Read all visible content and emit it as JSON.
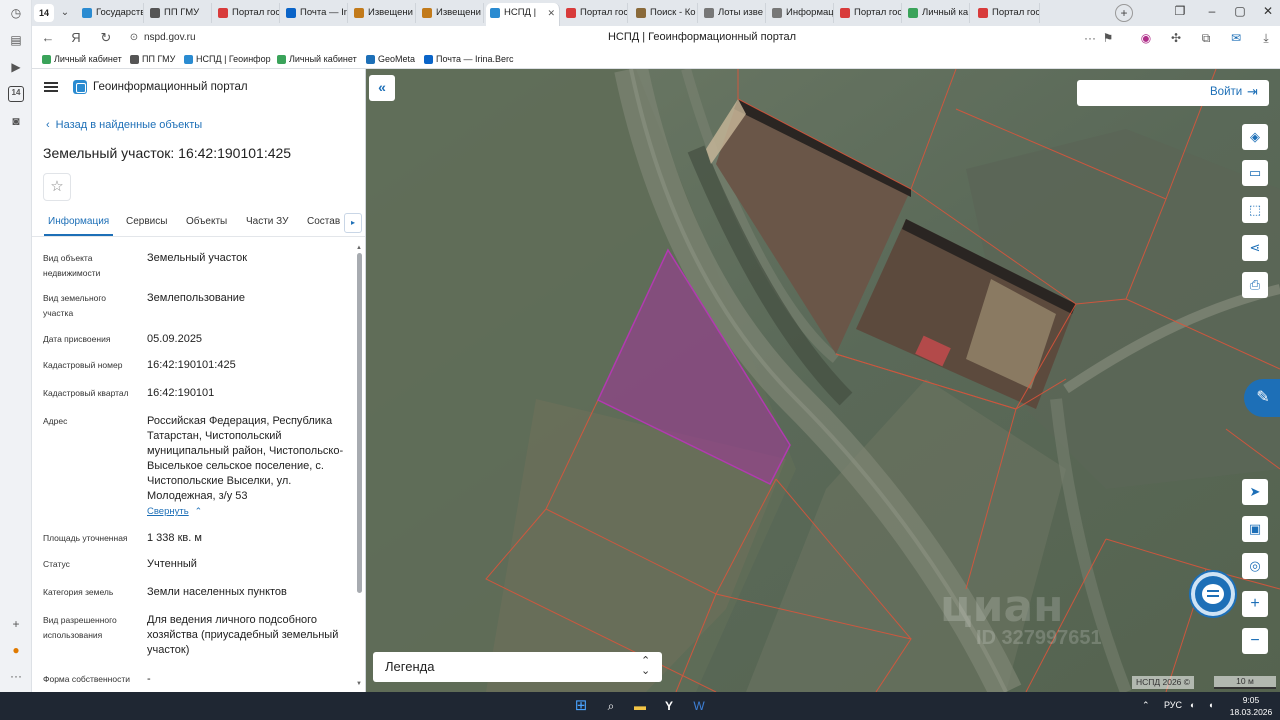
{
  "browser": {
    "tab_count": "14",
    "tabs": [
      {
        "label": "Государств",
        "color": "#2a8bd1"
      },
      {
        "label": "ПП ГМУ",
        "color": "#555555"
      },
      {
        "label": "Портал гос",
        "color": "#d83b3b"
      },
      {
        "label": "Почта — Ir",
        "color": "#0a64c8"
      },
      {
        "label": "Извещени",
        "color": "#c27a1a"
      },
      {
        "label": "Извещени",
        "color": "#c27a1a"
      },
      {
        "label": "НСПД |",
        "color": "#2a8bd1"
      },
      {
        "label": "Портал гос",
        "color": "#d83b3b"
      },
      {
        "label": "Поиск - Ко",
        "color": "#8a6a3a"
      },
      {
        "label": "Лоты изве",
        "color": "#777777"
      },
      {
        "label": "Информац",
        "color": "#777777"
      },
      {
        "label": "Портал гос",
        "color": "#d83b3b"
      },
      {
        "label": "Личный ка",
        "color": "#3aa35a"
      },
      {
        "label": "Портал гос",
        "color": "#d83b3b"
      }
    ],
    "url": "nspd.gov.ru",
    "page_title": "НСПД | Геоинформационный портал",
    "bookmarks": [
      {
        "label": "Личный кабинет",
        "color": "#3aa35a"
      },
      {
        "label": "ПП ГМУ",
        "color": "#555555"
      },
      {
        "label": "НСПД | Геоинфор",
        "color": "#2a8bd1"
      },
      {
        "label": "Личный кабинет",
        "color": "#3aa35a"
      },
      {
        "label": "GeoMeta",
        "color": "#1d6fb7"
      },
      {
        "label": "Почта — Irina.Berc",
        "color": "#0a64c8"
      }
    ]
  },
  "panel": {
    "app_title": "Геоинформационный портал",
    "back_label": "Назад в найденные объекты",
    "object_title": "Земельный участок: 16:42:190101:425",
    "tabs": [
      "Информация",
      "Сервисы",
      "Объекты",
      "Части ЗУ",
      "Состав"
    ],
    "properties": [
      {
        "label": "Вид объекта недвижимости",
        "value": "Земельный участок"
      },
      {
        "label": "Вид земельного участка",
        "value": "Землепользование"
      },
      {
        "label": "Дата присвоения",
        "value": "05.09.2025"
      },
      {
        "label": "Кадастровый номер",
        "value": "16:42:190101:425"
      },
      {
        "label": "Кадастровый квартал",
        "value": "16:42:190101"
      },
      {
        "label": "Адрес",
        "value": "Российская Федерация, Республика Татарстан, Чистопольский муниципальный район, Чистопольско-Выселькое сельское поселение, с. Чистопольские Выселки, ул. Молодежная, з/у 53"
      },
      {
        "label": "Площадь уточненная",
        "value": "1 338 кв. м"
      },
      {
        "label": "Статус",
        "value": "Учтенный"
      },
      {
        "label": "Категория земель",
        "value": "Земли населенных пунктов"
      },
      {
        "label": "Вид разрешенного использования",
        "value": "Для ведения личного подсобного хозяйства (приусадебный земельный участок)"
      },
      {
        "label": "Форма собственности",
        "value": "-"
      }
    ],
    "collapse_label": "Свернуть"
  },
  "map": {
    "login_label": "Войти",
    "legend_label": "Легенда",
    "copyright": "НСПД 2026 ©",
    "scale_label": "10 м",
    "watermark": "циан",
    "watermark_id": "ID 327997651",
    "selected_parcel_color": "#a0359a",
    "parcel_border_color": "#e0543a"
  },
  "taskbar": {
    "lang": "РУС",
    "time": "9:05",
    "date": "18.03.2026"
  }
}
